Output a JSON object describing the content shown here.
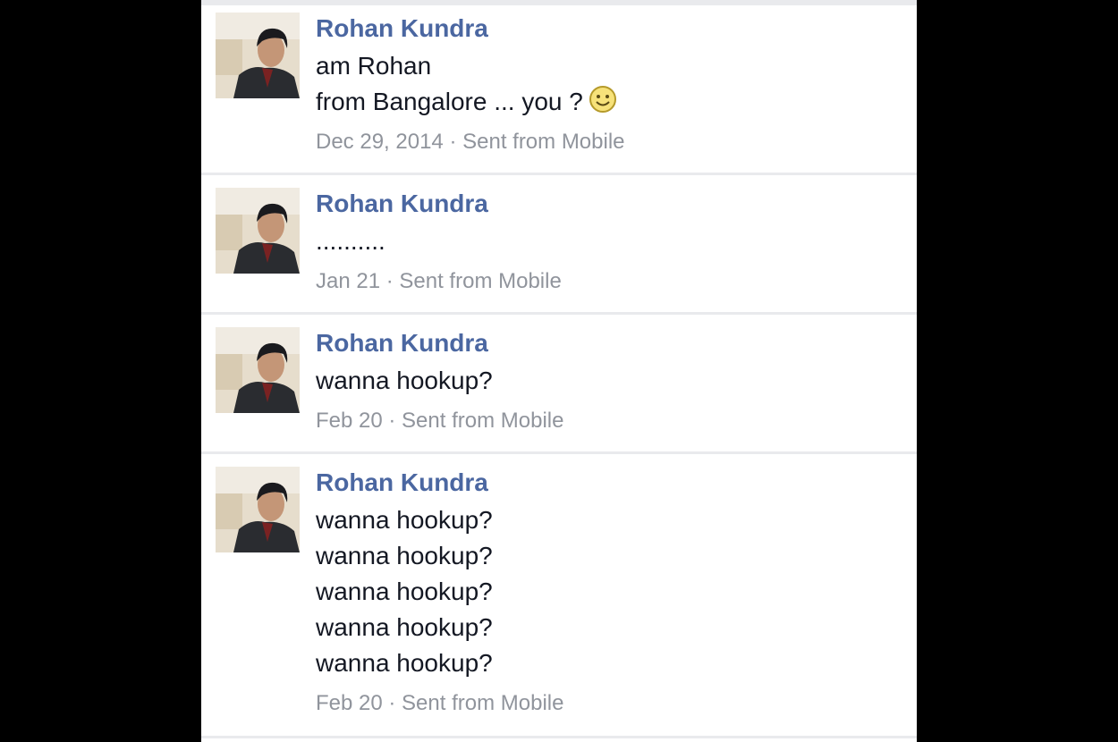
{
  "conversation": {
    "messages": [
      {
        "sender": "Rohan Kundra",
        "lines": [
          "am Rohan",
          "from Bangalore ... you ?"
        ],
        "emoji": "smiley-icon",
        "date": "Dec 29, 2014",
        "separator": " · ",
        "source": "Sent from Mobile"
      },
      {
        "sender": "Rohan Kundra",
        "lines": [
          ".........."
        ],
        "date": "Jan 21",
        "separator": " · ",
        "source": "Sent from Mobile"
      },
      {
        "sender": "Rohan Kundra",
        "lines": [
          "wanna hookup?"
        ],
        "date": "Feb 20",
        "separator": " · ",
        "source": "Sent from Mobile"
      },
      {
        "sender": "Rohan Kundra",
        "lines": [
          "wanna hookup?",
          "wanna hookup?",
          "wanna hookup?",
          "wanna hookup?",
          "wanna hookup?"
        ],
        "date": "Feb 20",
        "separator": " · ",
        "source": "Sent from Mobile"
      }
    ]
  },
  "colors": {
    "sender_name": "#4b67a1",
    "message_text": "#141823",
    "meta_text": "#90949c",
    "divider": "#e9eaed",
    "letterbox": "#000000"
  }
}
